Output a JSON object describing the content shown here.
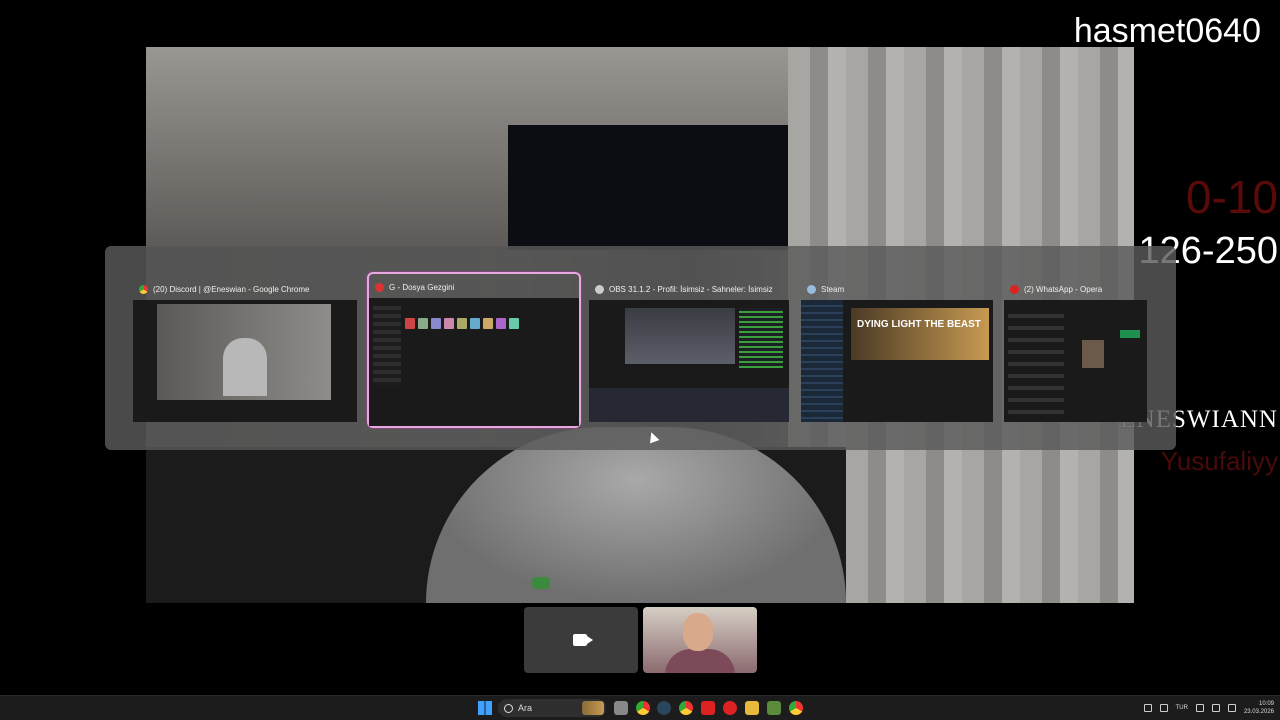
{
  "overlay": {
    "username": "hasmet0640",
    "score_red": "0-10",
    "score_white": "126-250",
    "name_white": "ENESWIANN",
    "name_red": "Yusufaliyy"
  },
  "task_switcher": {
    "windows": [
      {
        "title": "(20) Discord | @Eneswian - Google Chrome",
        "icon": "chrome-icon",
        "selected": false
      },
      {
        "title": "G - Dosya Gezgini",
        "icon": "file-explorer-icon",
        "selected": true
      },
      {
        "title": "OBS 31.1.2 - Profil: İsimsiz - Sahneler: İsimsiz",
        "icon": "obs-icon",
        "selected": false
      },
      {
        "title": "Steam",
        "icon": "steam-icon",
        "selected": false
      },
      {
        "title": "(2) WhatsApp - Opera",
        "icon": "opera-icon",
        "selected": false
      }
    ],
    "steam_game_text": "DYING LIGHT THE BEAST"
  },
  "taskbar": {
    "search_placeholder": "Ara",
    "language": "TUR",
    "time": "10:09",
    "date": "23.03.2026",
    "apps": [
      "windows-start-icon",
      "search-icon",
      "widgets-icon",
      "task-view-icon",
      "chrome-alt-icon",
      "steam-icon",
      "chrome-icon",
      "acrobat-icon",
      "opera-icon",
      "file-explorer-icon",
      "minecraft-icon",
      "chrome-active-icon"
    ]
  },
  "colors": {
    "selection_border": "#e8a7e0",
    "score_red": "#5b0a0a",
    "accent_blue": "#3fa0ff"
  }
}
